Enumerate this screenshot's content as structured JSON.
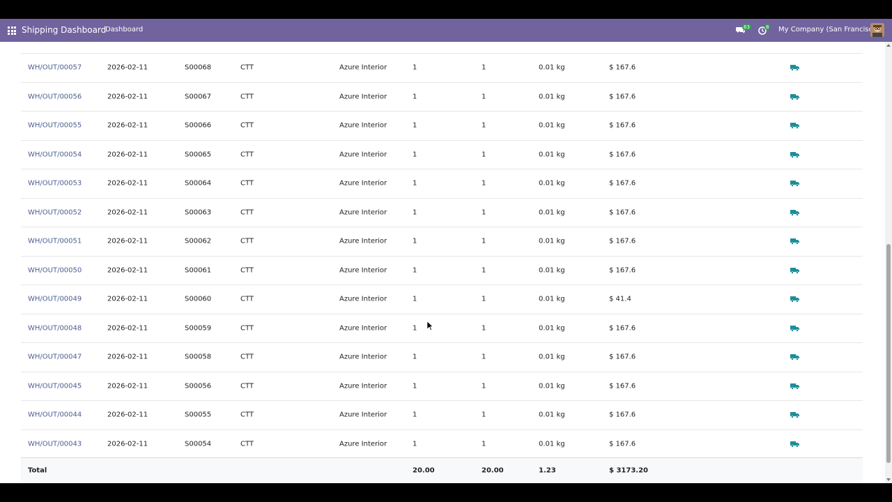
{
  "header": {
    "app_title": "Shipping Dashboard",
    "nav_item": "Dashboard",
    "chat_badge": "63",
    "activity_badge": "8",
    "company": "My Company (San Francisco)"
  },
  "colors": {
    "topbar": "#71639e",
    "link": "#4c5f91",
    "truck": "#1c8d9a"
  },
  "rows": [
    {
      "ref": "WH/OUT/00057",
      "date": "2026-02-11",
      "order": "S00068",
      "carrier": "CTT",
      "partner": "Azure Interior",
      "qty1": "1",
      "qty2": "1",
      "weight": "0.01 kg",
      "price": "$ 167.6"
    },
    {
      "ref": "WH/OUT/00056",
      "date": "2026-02-11",
      "order": "S00067",
      "carrier": "CTT",
      "partner": "Azure Interior",
      "qty1": "1",
      "qty2": "1",
      "weight": "0.01 kg",
      "price": "$ 167.6"
    },
    {
      "ref": "WH/OUT/00055",
      "date": "2026-02-11",
      "order": "S00066",
      "carrier": "CTT",
      "partner": "Azure Interior",
      "qty1": "1",
      "qty2": "1",
      "weight": "0.01 kg",
      "price": "$ 167.6"
    },
    {
      "ref": "WH/OUT/00054",
      "date": "2026-02-11",
      "order": "S00065",
      "carrier": "CTT",
      "partner": "Azure Interior",
      "qty1": "1",
      "qty2": "1",
      "weight": "0.01 kg",
      "price": "$ 167.6"
    },
    {
      "ref": "WH/OUT/00053",
      "date": "2026-02-11",
      "order": "S00064",
      "carrier": "CTT",
      "partner": "Azure Interior",
      "qty1": "1",
      "qty2": "1",
      "weight": "0.01 kg",
      "price": "$ 167.6"
    },
    {
      "ref": "WH/OUT/00052",
      "date": "2026-02-11",
      "order": "S00063",
      "carrier": "CTT",
      "partner": "Azure Interior",
      "qty1": "1",
      "qty2": "1",
      "weight": "0.01 kg",
      "price": "$ 167.6"
    },
    {
      "ref": "WH/OUT/00051",
      "date": "2026-02-11",
      "order": "S00062",
      "carrier": "CTT",
      "partner": "Azure Interior",
      "qty1": "1",
      "qty2": "1",
      "weight": "0.01 kg",
      "price": "$ 167.6"
    },
    {
      "ref": "WH/OUT/00050",
      "date": "2026-02-11",
      "order": "S00061",
      "carrier": "CTT",
      "partner": "Azure Interior",
      "qty1": "1",
      "qty2": "1",
      "weight": "0.01 kg",
      "price": "$ 167.6"
    },
    {
      "ref": "WH/OUT/00049",
      "date": "2026-02-11",
      "order": "S00060",
      "carrier": "CTT",
      "partner": "Azure Interior",
      "qty1": "1",
      "qty2": "1",
      "weight": "0.01 kg",
      "price": "$ 41.4"
    },
    {
      "ref": "WH/OUT/00048",
      "date": "2026-02-11",
      "order": "S00059",
      "carrier": "CTT",
      "partner": "Azure Interior",
      "qty1": "1",
      "qty2": "1",
      "weight": "0.01 kg",
      "price": "$ 167.6"
    },
    {
      "ref": "WH/OUT/00047",
      "date": "2026-02-11",
      "order": "S00058",
      "carrier": "CTT",
      "partner": "Azure Interior",
      "qty1": "1",
      "qty2": "1",
      "weight": "0.01 kg",
      "price": "$ 167.6"
    },
    {
      "ref": "WH/OUT/00045",
      "date": "2026-02-11",
      "order": "S00056",
      "carrier": "CTT",
      "partner": "Azure Interior",
      "qty1": "1",
      "qty2": "1",
      "weight": "0.01 kg",
      "price": "$ 167.6"
    },
    {
      "ref": "WH/OUT/00044",
      "date": "2026-02-11",
      "order": "S00055",
      "carrier": "CTT",
      "partner": "Azure Interior",
      "qty1": "1",
      "qty2": "1",
      "weight": "0.01 kg",
      "price": "$ 167.6"
    },
    {
      "ref": "WH/OUT/00043",
      "date": "2026-02-11",
      "order": "S00054",
      "carrier": "CTT",
      "partner": "Azure Interior",
      "qty1": "1",
      "qty2": "1",
      "weight": "0.01 kg",
      "price": "$ 167.6"
    }
  ],
  "total": {
    "label": "Total",
    "qty1": "20.00",
    "qty2": "20.00",
    "weight": "1.23",
    "price": "$ 3173.20"
  }
}
